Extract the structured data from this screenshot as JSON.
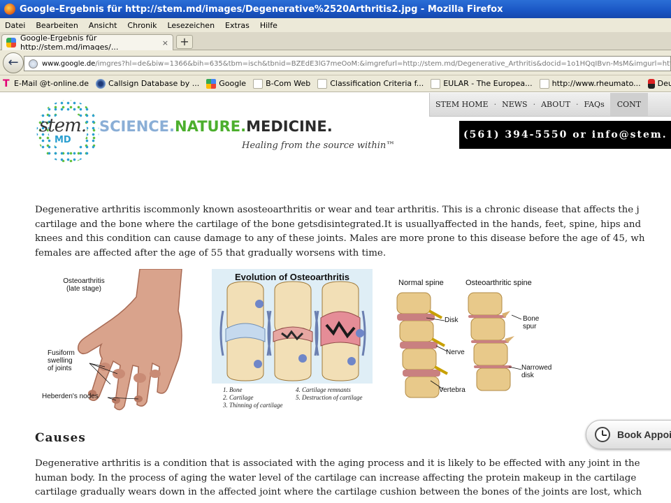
{
  "window": {
    "title": "Google-Ergebnis für http://stem.md/images/Degenerative%2520Arthritis2.jpg - Mozilla Firefox"
  },
  "menubar": {
    "items": [
      "Datei",
      "Bearbeiten",
      "Ansicht",
      "Chronik",
      "Lesezeichen",
      "Extras",
      "Hilfe"
    ]
  },
  "tab": {
    "label": "Google-Ergebnis für http://stem.md/images/...",
    "close": "×",
    "new_tab": "+"
  },
  "navbar": {
    "url_host": "www.google.de",
    "url_rest": "/imgres?hl=de&biw=1366&bih=635&tbm=isch&tbnid=BZEdE3lG7meOoM:&imgrefurl=http://stem.md/Degenerative_Arthritis&docid=1o1HQqIBvn-MsM&imgurl=http://stem"
  },
  "bookmarks": [
    {
      "label": "E-Mail @t-online.de",
      "icon": "t"
    },
    {
      "label": "Callsign Database by ...",
      "icon": "cs"
    },
    {
      "label": "Google",
      "icon": "g"
    },
    {
      "label": "B-Com Web",
      "icon": "page"
    },
    {
      "label": "Classification Criteria f...",
      "icon": "page"
    },
    {
      "label": "EULAR - The Europea...",
      "icon": "page"
    },
    {
      "label": "http://www.rheumato...",
      "icon": "page"
    },
    {
      "label": "Deutsche Gesellschaf",
      "icon": "dg"
    }
  ],
  "site": {
    "logo_stem": "stem.",
    "logo_md": "MD",
    "tagline": {
      "science": "SCIENCE.",
      "nature": "NATURE.",
      "medicine": "MEDICINE."
    },
    "subtagline": "Healing from the source within™",
    "nav": [
      "STEM HOME",
      "NEWS",
      "ABOUT",
      "FAQs",
      "CONT"
    ],
    "nav_sep": "·",
    "contact": "(561) 394-5550 or info@stem."
  },
  "content": {
    "intro_lines": [
      "Degenerative arthritis iscommonly known asosteoarthritis or wear and tear arthritis. This is a chronic disease that affects the j",
      "cartilage and the bone where the cartilage of the bone getsdisintegrated.It is usuallyaffected in the hands, feet, spine, hips and",
      "knees and this condition can cause damage to any of these joints. Males are more prone to this disease before the age of 45, wh",
      "females are affected after the age of 55 that gradually worsens with time."
    ],
    "causes_heading": "Causes",
    "causes_lines": [
      "Degenerative arthritis is a condition that is associated with the aging process and it is likely to be effected with any joint in the",
      "human body. In the process of aging the water level of the cartilage can increase affecting the protein makeup in the cartilage",
      "cartilage gradually wears down in the affected joint where the cartilage cushion between the bones of the joints are lost, which"
    ]
  },
  "figures": {
    "hand": {
      "title": "Osteoarthritis\n(late stage)",
      "label_fusiform": "Fusiform\nswelling\nof joints",
      "label_heberden": "Heberden's nodes"
    },
    "evolution": {
      "title": "Evolution of Osteoarthritis",
      "markers": [
        "1",
        "2",
        "3",
        "4",
        "5"
      ],
      "legend_left": [
        "1.  Bone",
        "2.  Cartilage",
        "3.  Thinning of cartilage"
      ],
      "legend_right": [
        "4.  Cartilage remnants",
        "5.  Destruction of cartilage"
      ]
    },
    "spine": {
      "title_normal": "Normal spine",
      "title_oa": "Osteoarthritic spine",
      "label_disk": "Disk",
      "label_nerve": "Nerve",
      "label_vertebra": "Vertebra",
      "label_spur": "Bone\nspur",
      "label_narrowed": "Narrowed\ndisk"
    }
  },
  "book_button": {
    "label": "Book Appoi"
  },
  "colors": {
    "titlebar": "#1a56c4",
    "chrome": "#ece9d8",
    "tag_science": "#8aaed6",
    "tag_nature": "#4caf2d",
    "contact_bg": "#000000"
  }
}
